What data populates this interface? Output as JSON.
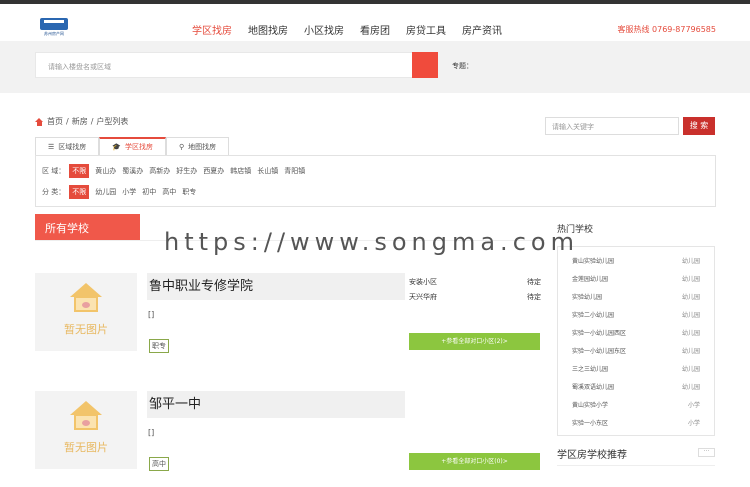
{
  "header": {
    "logo_text": "苏州房产网",
    "nav": [
      "学区找房",
      "地图找房",
      "小区找房",
      "看房团",
      "房贷工具",
      "房产资讯"
    ],
    "hotline": "客服热线 0769-87796585"
  },
  "search": {
    "placeholder": "请输入楼盘名或区域",
    "hot_label": "专题："
  },
  "breadcrumb": {
    "home": "首页",
    "sep1": "/",
    "new": "新房",
    "sep2": "/",
    "list": "户型列表"
  },
  "keyword": {
    "placeholder": "请输入关键字",
    "button": "搜 索"
  },
  "tabs": [
    "区域找房",
    "学区找房",
    "地图找房"
  ],
  "filter": {
    "area_label": "区 域：",
    "area_options": [
      "不限",
      "黄山办",
      "蜀溪办",
      "高新办",
      "好生办",
      "西夏办",
      "韩店镇",
      "长山镇",
      "青阳镇"
    ],
    "type_label": "分 类：",
    "type_options": [
      "不限",
      "幼儿园",
      "小学",
      "初中",
      "高中",
      "职专"
    ]
  },
  "section_title": "所有学校",
  "schools": [
    {
      "name": "鲁中职业专修学院",
      "braces": "[]",
      "tag": "职专",
      "estates": [
        {
          "name": "安装小区",
          "price": "待定"
        },
        {
          "name": "天兴华府",
          "price": "待定"
        }
      ],
      "button": "+参看全部对口小区(2)>"
    },
    {
      "name": "邹平一中",
      "braces": "[]",
      "tag": "高中",
      "estates": [],
      "button": "+参看全部对口小区(0)>"
    }
  ],
  "no_image_caption": "暂无图片",
  "sidebar": {
    "hot_title": "热门学校",
    "hot_list": [
      {
        "name": "黄山实验幼儿园",
        "type": "幼儿园"
      },
      {
        "name": "金莲园幼儿园",
        "type": "幼儿园"
      },
      {
        "name": "实验幼儿园",
        "type": "幼儿园"
      },
      {
        "name": "实验二小幼儿园",
        "type": "幼儿园"
      },
      {
        "name": "实验一小幼儿园西区",
        "type": "幼儿园"
      },
      {
        "name": "实验一小幼儿园东区",
        "type": "幼儿园"
      },
      {
        "name": "三之三幼儿园",
        "type": "幼儿园"
      },
      {
        "name": "蜀溪双语幼儿园",
        "type": "幼儿园"
      },
      {
        "name": "黄山实验小学",
        "type": "小学"
      },
      {
        "name": "实验一小东区",
        "type": "小学"
      }
    ],
    "recommend_title": "学区房学校推荐",
    "more": "···"
  },
  "watermark": "https://www.songma.com",
  "colors": {
    "accent": "#e54b3c",
    "green": "#8cc63f"
  }
}
